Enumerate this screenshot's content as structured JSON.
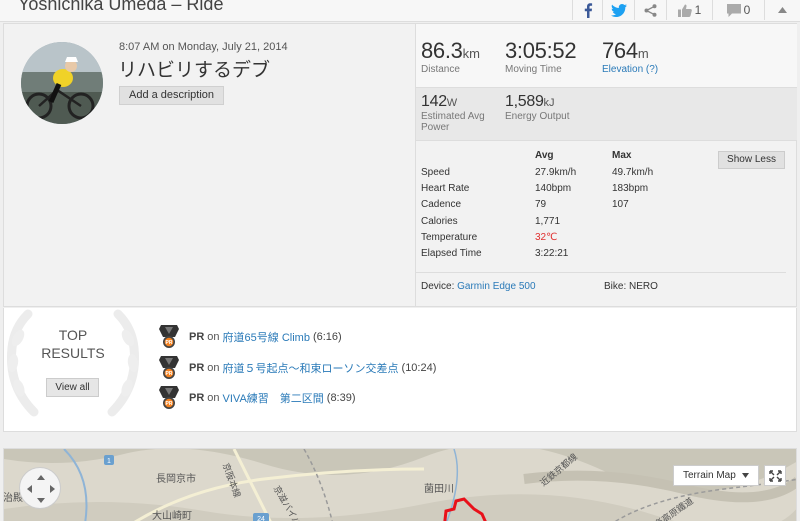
{
  "header": {
    "title": "Yoshichika Umeda – Ride",
    "kudos_count": "1",
    "comments_count": "0",
    "icons": [
      "facebook-icon",
      "twitter-icon",
      "share-icon",
      "kudos-thumb-icon",
      "comment-icon",
      "collapse-caret-icon"
    ]
  },
  "activity": {
    "datetime": "8:07 AM on Monday, July 21, 2014",
    "name": "リハビリするデブ",
    "add_description": "Add a description"
  },
  "stats": {
    "distance": {
      "value": "86.3",
      "unit": "km",
      "label": "Distance"
    },
    "moving_time": {
      "value": "3:05:52",
      "label": "Moving Time"
    },
    "elevation": {
      "value": "764",
      "unit": "m",
      "label": "Elevation (?)"
    },
    "power": {
      "value": "142",
      "unit": "W",
      "label_line1": "Estimated Avg",
      "label_line2": "Power"
    },
    "energy": {
      "value": "1,589",
      "unit": "kJ",
      "label": "Energy Output"
    }
  },
  "details": {
    "col_avg": "Avg",
    "col_max": "Max",
    "show_less": "Show Less",
    "rows": [
      {
        "label": "Speed",
        "avg": "27.9km/h",
        "max": "49.7km/h"
      },
      {
        "label": "Heart Rate",
        "avg": "140bpm",
        "max": "183bpm"
      },
      {
        "label": "Cadence",
        "avg": "79",
        "max": "107"
      },
      {
        "label": "Calories",
        "avg": "1,771",
        "max": ""
      },
      {
        "label": "Temperature",
        "avg": "32℃",
        "max": ""
      },
      {
        "label": "Elapsed Time",
        "avg": "3:22:21",
        "max": ""
      }
    ],
    "temperature_color": "#e03030",
    "device_label": "Device:",
    "device_name": "Garmin Edge 500",
    "bike_label": "Bike:",
    "bike_name": "NERO"
  },
  "top_results": {
    "title_line1": "TOP",
    "title_line2": "RESULTS",
    "view_all": "View all",
    "items": [
      {
        "badge": "PR",
        "on": "on",
        "segment": "府道65号線 Climb",
        "time": "(6:16)"
      },
      {
        "badge": "PR",
        "on": "on",
        "segment": "府道５号起点〜和束ローソン交差点",
        "time": "(10:24)"
      },
      {
        "badge": "PR",
        "on": "on",
        "segment": "VIVA練習　第二区間",
        "time": "(8:39)"
      }
    ]
  },
  "map": {
    "map_type": "Terrain Map",
    "labels": [
      "長岡京市",
      "大山崎町",
      "治殿",
      "京滋バイパス",
      "京阪本線",
      "菌田川",
      "近鉄京都線",
      "信楽高原鐵道",
      "24",
      "1"
    ],
    "route_color": "#e8101a"
  },
  "colors": {
    "link": "#2a7ab8",
    "accent": "#fc4c02"
  }
}
